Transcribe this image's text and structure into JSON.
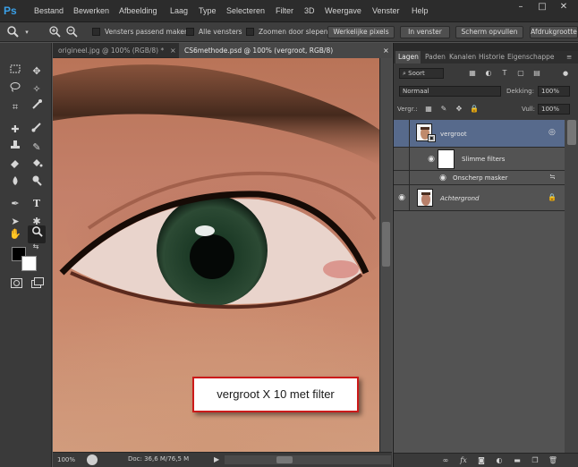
{
  "app": {
    "logo": "Ps"
  },
  "menu": [
    "Bestand",
    "Bewerken",
    "Afbeelding",
    "Laag",
    "Type",
    "Selecteren",
    "Filter",
    "3D",
    "Weergave",
    "Venster",
    "Help"
  ],
  "window_controls": {
    "minimize": "–",
    "restore": "□",
    "close": "✕"
  },
  "options": {
    "checkbox_resize_windows": "Vensters passend maken",
    "checkbox_all_windows": "Alle vensters",
    "checkbox_scrubby_zoom": "Zoomen door slepen",
    "btn_actual_pixels": "Werkelijke pixels",
    "btn_fit_screen": "In venster",
    "btn_fill_screen": "Scherm opvullen",
    "btn_print_size": "Afdrukgrootte"
  },
  "tabs": [
    {
      "label": "origineel.jpg @ 100% (RGB/8) *",
      "close": "×"
    },
    {
      "label": "CS6methode.psd @ 100% (vergroot, RGB/8)",
      "close": "×"
    }
  ],
  "status": {
    "zoom": "100%",
    "doc": "Doc: 36,6 M/76,5 M"
  },
  "callout": {
    "text": "vergroot X 10 met filter"
  },
  "panel": {
    "tabs": [
      "Lagen",
      "Paden",
      "Kanalen",
      "Historie",
      "Eigenschappe"
    ],
    "filter_label": "Soort",
    "blend_mode": "Normaal",
    "opacity_label": "Dekking:",
    "opacity_value": "100%",
    "lock_label": "Vergr.:",
    "fill_label": "Vull:",
    "fill_value": "100%",
    "layers": [
      {
        "name": "vergroot"
      },
      {
        "name": "Slimme filters"
      },
      {
        "name": "Onscherp masker"
      },
      {
        "name": "Achtergrond"
      }
    ]
  },
  "icons": {
    "zoom_tool": "🔍",
    "eye": "◉",
    "lock": "🔒"
  }
}
